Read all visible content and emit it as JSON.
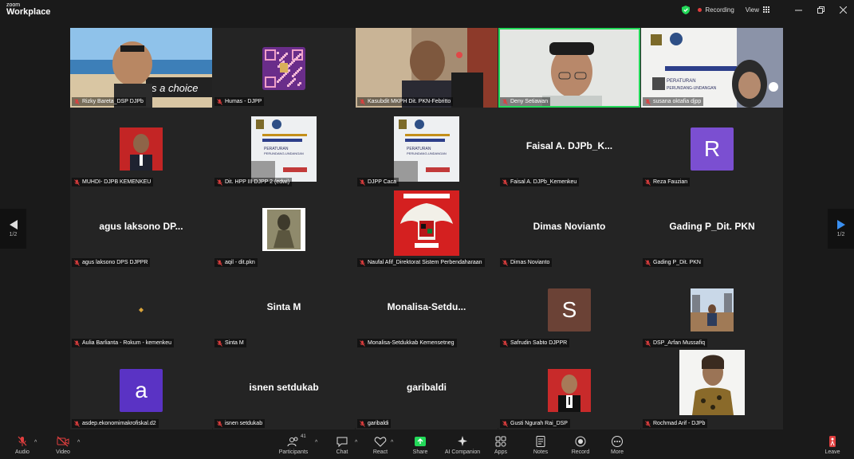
{
  "titlebar": {
    "logo_top": "zoom",
    "logo_bottom": "Workplace",
    "recording": "Recording",
    "view": "View"
  },
  "pager": {
    "left": "1/2",
    "right": "1/2"
  },
  "tiles": [
    {
      "name": "Rizky Bareta_DSP DJPb",
      "kind": "video",
      "scene": "beach"
    },
    {
      "name": "Humas - DJPP",
      "kind": "qr"
    },
    {
      "name": "Kasubdit MKPH Dit. PKN-Febritto",
      "kind": "video",
      "scene": "office"
    },
    {
      "name": "Deny Setiawan",
      "kind": "video",
      "scene": "white",
      "active": true
    },
    {
      "name": "susana oktafia djpp",
      "kind": "video",
      "scene": "banner"
    },
    {
      "name": "MUHDI- DJPB KEMENKEU",
      "kind": "photo",
      "photo": "redsuit"
    },
    {
      "name": "Dit. HPP III DJPP 2 (edwi)",
      "kind": "poster"
    },
    {
      "name": "DJPP Caca",
      "kind": "poster"
    },
    {
      "name": "Faisal A. DJPb_Kemenkeu",
      "kind": "text",
      "display": "Faisal A. DJPb_K..."
    },
    {
      "name": "Reza Fauzian",
      "kind": "avatar",
      "letter": "R",
      "color": "#7b4fd1"
    },
    {
      "name": "agus laksono DPS DJPPR",
      "kind": "text",
      "display": "agus laksono DP..."
    },
    {
      "name": "aqil - dit.pkn",
      "kind": "photo",
      "photo": "art"
    },
    {
      "name": "Naufal Afif_Direktorat Sistem Perbendaharaan",
      "kind": "photo",
      "photo": "garuda"
    },
    {
      "name": "Dimas Novianto",
      "kind": "text",
      "display": "Dimas Novianto"
    },
    {
      "name": "Gading P_Dit. PKN",
      "kind": "text",
      "display": "Gading P_Dit. PKN"
    },
    {
      "name": "Aulia Barlianta - Rokum - kemenkeu",
      "kind": "photo",
      "photo": "tiny"
    },
    {
      "name": "Sinta M",
      "kind": "text",
      "display": "Sinta M"
    },
    {
      "name": "Monalisa-Setdukkab Kemensetneg",
      "kind": "text",
      "display": "Monalisa-Setdu..."
    },
    {
      "name": "Safrudin Sabto DJPPR",
      "kind": "avatar",
      "letter": "S",
      "color": "#6b4236"
    },
    {
      "name": "DSP_Arfan Mussafiq",
      "kind": "photo",
      "photo": "outdoor"
    },
    {
      "name": "asdep.ekonomimakrofiskal.d2",
      "kind": "avatar",
      "letter": "a",
      "color": "#5a33c4"
    },
    {
      "name": "isnen setdukab",
      "kind": "text",
      "display": "isnen setdukab"
    },
    {
      "name": "garibaldi",
      "kind": "text",
      "display": "garibaldi"
    },
    {
      "name": "Gusti Ngurah Rai_DSP",
      "kind": "photo",
      "photo": "redsuit2"
    },
    {
      "name": "Rochmad Arif - DJPb",
      "kind": "photo",
      "photo": "batik"
    }
  ],
  "toolbar": {
    "audio": "Audio",
    "video": "Video",
    "participants": "Participants",
    "participants_count": "41",
    "chat": "Chat",
    "react": "React",
    "share": "Share",
    "ai": "AI Companion",
    "apps": "Apps",
    "notes": "Notes",
    "record": "Record",
    "more": "More",
    "leave": "Leave"
  },
  "colors": {
    "active_border": "#23d959",
    "share_green": "#23d959",
    "leave_red": "#e03e3e"
  }
}
